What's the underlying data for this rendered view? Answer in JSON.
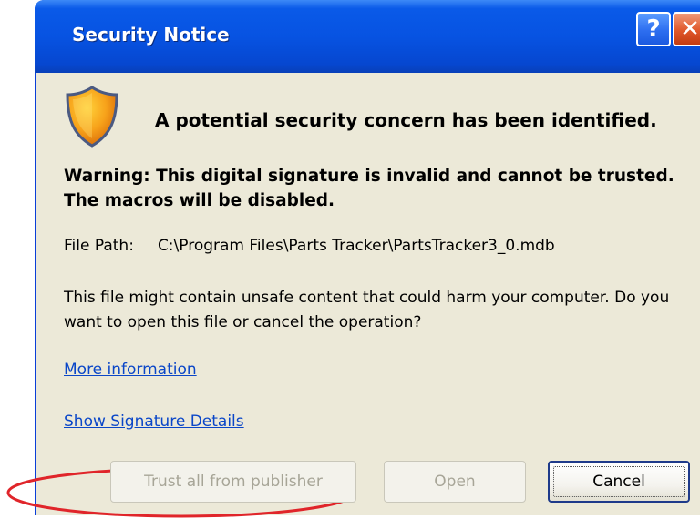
{
  "window": {
    "title": "Security Notice"
  },
  "titlebar": {
    "help_label": "?",
    "close_label": "✕"
  },
  "icons": {
    "shield": "shield-warning-icon"
  },
  "content": {
    "heading": "A potential security concern has been identified.",
    "warning": "Warning: This digital signature is invalid and cannot be trusted. The macros will be disabled.",
    "file_path_label": "File Path:",
    "file_path_value": "C:\\Program Files\\Parts Tracker\\PartsTracker3_0.mdb",
    "description": "This file might contain unsafe content that could harm your computer. Do you want to open this file or cancel the operation?"
  },
  "links": {
    "more_information": "More information",
    "show_signature_details": "Show Signature Details"
  },
  "buttons": {
    "trust_all": "Trust all from publisher",
    "open": "Open",
    "cancel": "Cancel"
  },
  "colors": {
    "titlebar": "#0753e2",
    "client_bg": "#ece9d8",
    "link": "#0a46c8",
    "annotation": "#e0252a"
  }
}
